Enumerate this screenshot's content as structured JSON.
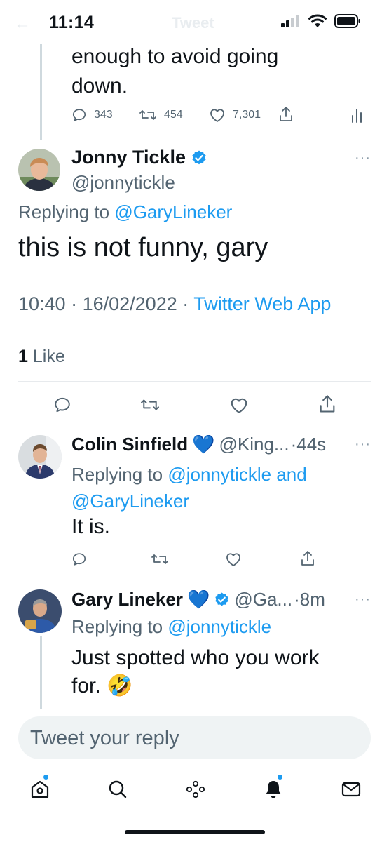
{
  "status_bar": {
    "time": "11:14",
    "ghost_title": "Tweet"
  },
  "previous_tweet": {
    "text_line1": "enough to avoid going",
    "text_line2": "down.",
    "replies": "343",
    "retweets": "454",
    "likes": "7,301"
  },
  "main_tweet": {
    "name": "Jonny Tickle",
    "handle": "@jonnytickle",
    "replying_label": "Replying to",
    "replying_to": "@GaryLineker",
    "text": "this is not funny, gary",
    "time": "10:40",
    "date": "16/02/2022",
    "source": "Twitter Web App",
    "like_count": "1",
    "like_label": "Like"
  },
  "replies": [
    {
      "name": "Colin Sinfield",
      "heart": "💙",
      "handle": "@King...",
      "age": "·44s",
      "replying_label": "Replying to",
      "replying_to_1": "@jonnytickle and",
      "replying_to_2": "@GaryLineker",
      "text": "It is."
    },
    {
      "name": "Gary Lineker",
      "heart": "💙",
      "handle": "@Ga...",
      "age": "·8m",
      "replying_label": "Replying to",
      "replying_to": "@jonnytickle",
      "text_line1": "Just spotted who you work",
      "text_line2": "for. 🤣"
    }
  ],
  "composer": {
    "placeholder": "Tweet your reply"
  },
  "tabs": [
    "home-icon",
    "search-icon",
    "spaces-icon",
    "notifications-icon",
    "messages-icon"
  ],
  "colors": {
    "accent": "#1d9bf0",
    "text": "#0f1419",
    "secondary": "#536471",
    "heart": "#1d6ff2"
  }
}
